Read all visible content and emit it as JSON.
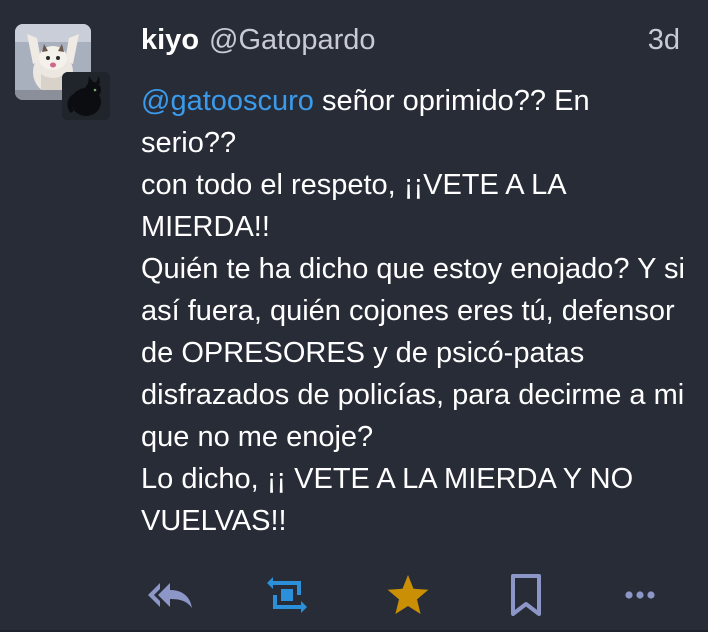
{
  "status": {
    "display_name": "kiyo",
    "username": "@Gatopardo",
    "timestamp": "3d",
    "mention": "@gatooscuro",
    "content": " señor oprimido?? En serio??\ncon todo el respeto, ¡¡VETE A LA MIERDA!!\nQuién te ha dicho que estoy enojado? Y si así fuera, quién cojones eres tú, defensor de OPRESORES y de psicó-patas disfrazados de policías, para decirme a mi que no me enoje?\nLo dicho, ¡¡ VETE A LA MIERDA Y NO VUELVAS!!"
  },
  "actions": {
    "reply_all_icon": "reply-all-icon",
    "boost_icon": "boost-icon",
    "favourite_icon": "star-icon",
    "favourited": true,
    "bookmark_icon": "bookmark-icon",
    "more_icon": "ellipsis-icon"
  },
  "colors": {
    "background": "#282c37",
    "text": "#ffffff",
    "muted_text": "#c8cbd4",
    "mention": "#3b9bea",
    "action_icon": "#8c96c7",
    "boost_icon": "#2b90d9",
    "favourite_icon": "#ca8f04"
  }
}
